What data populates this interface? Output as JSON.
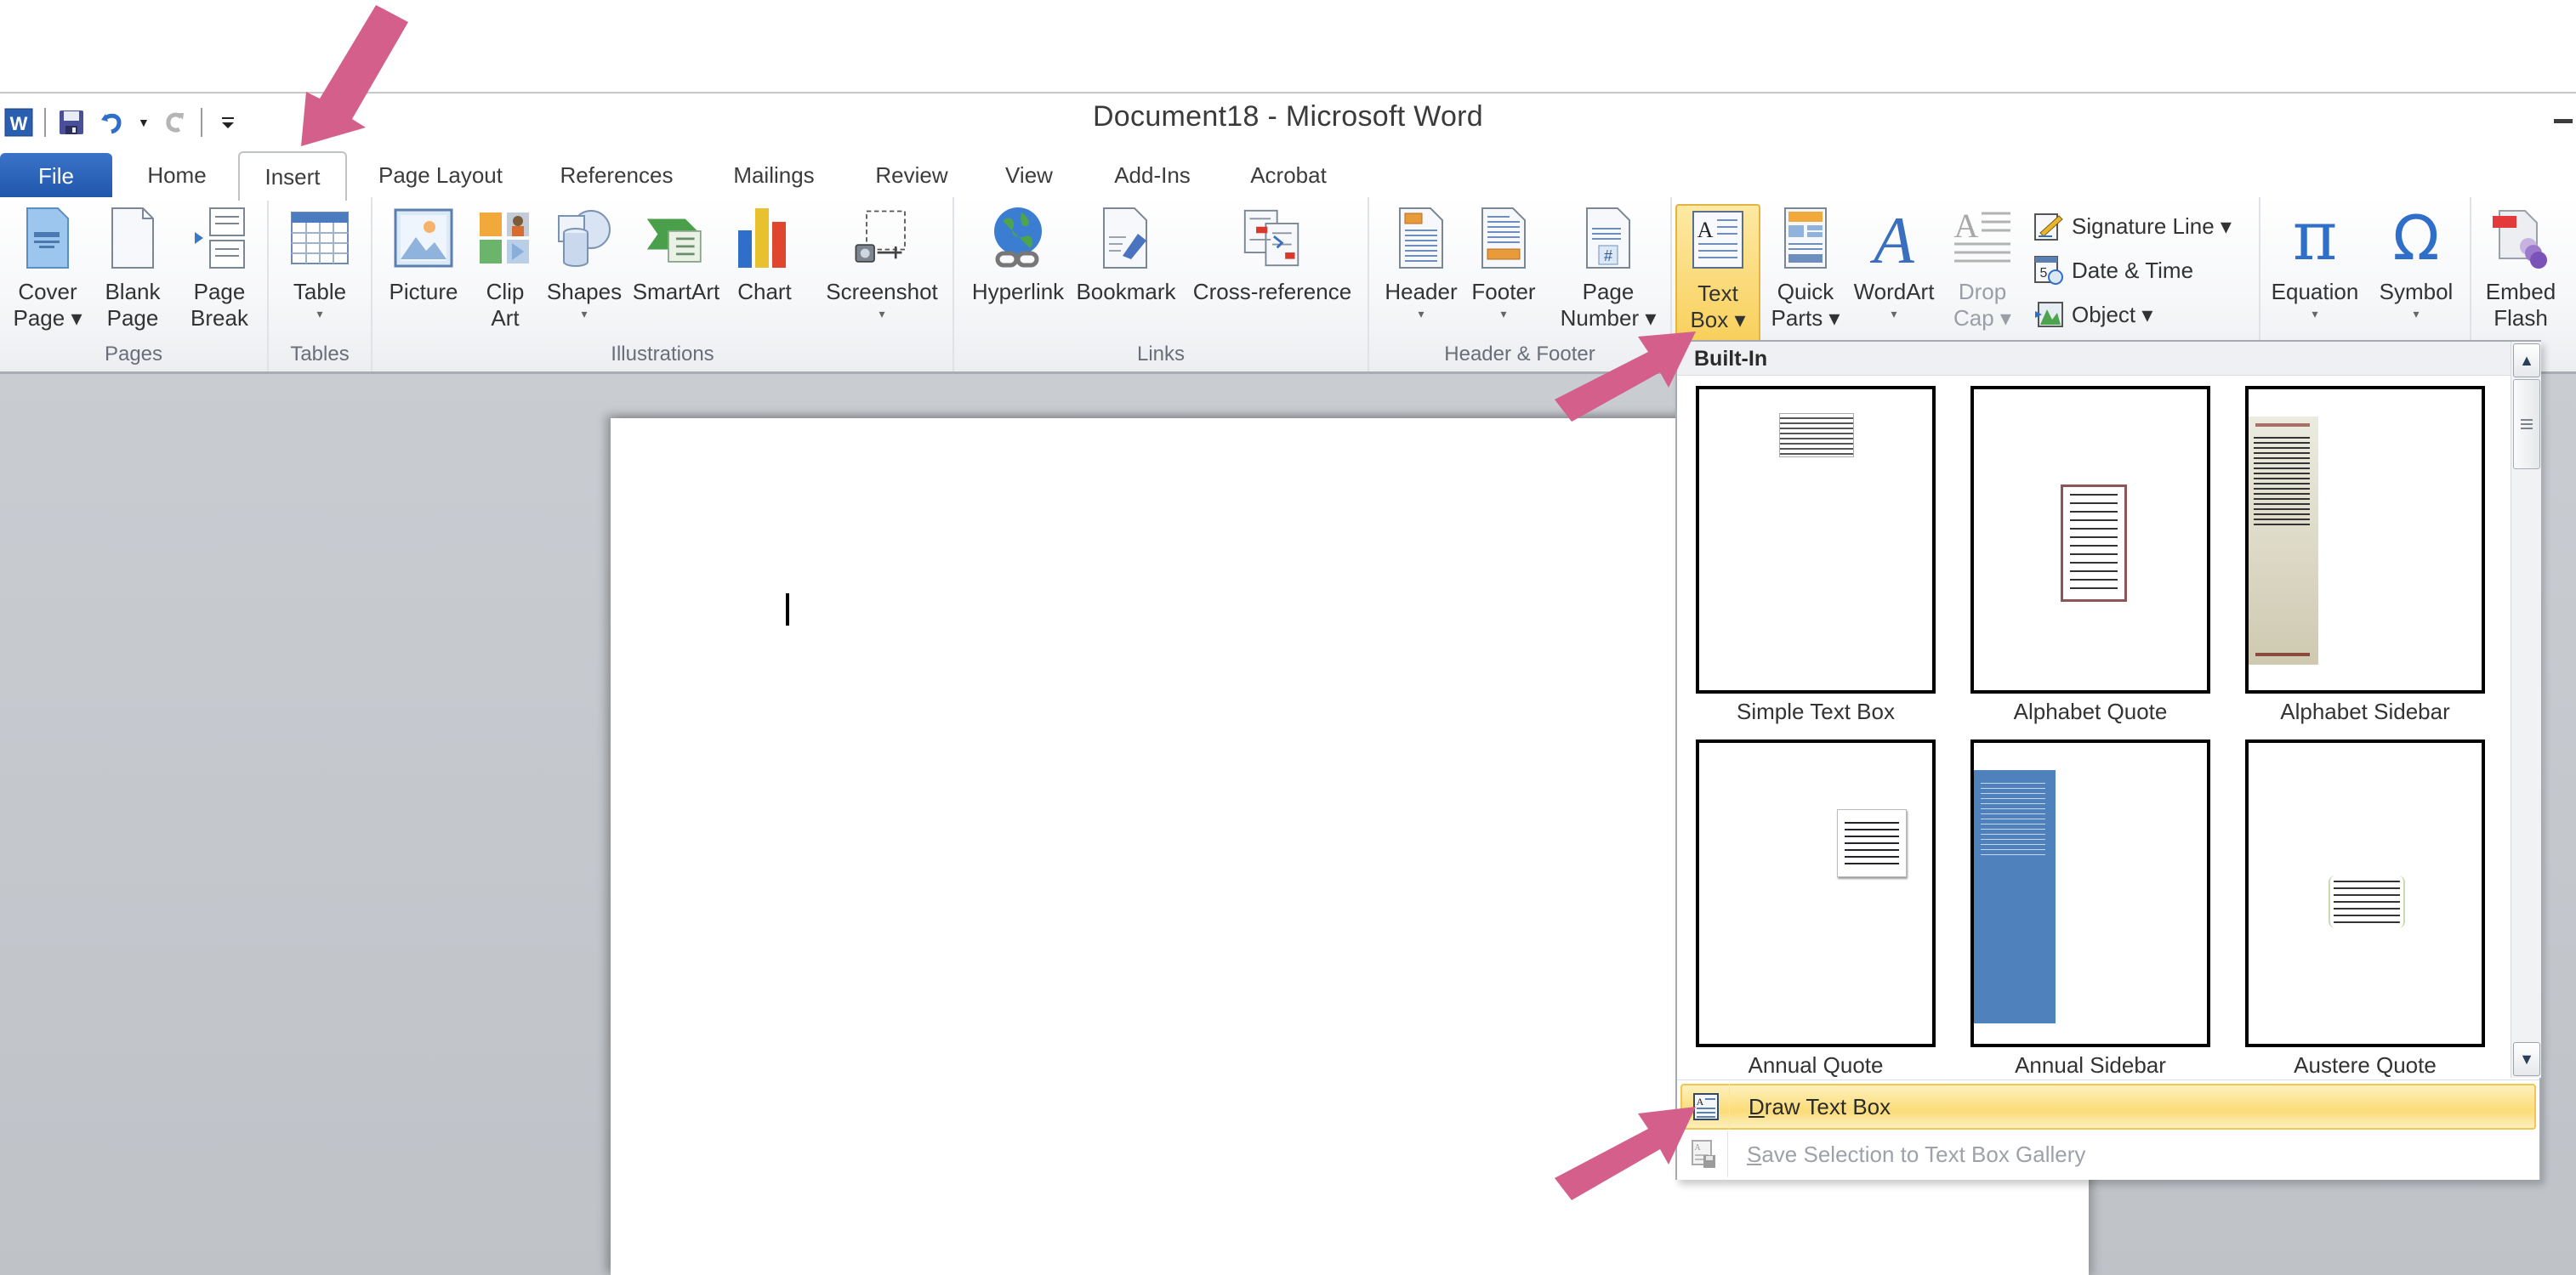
{
  "window": {
    "title": "Document18 - Microsoft Word"
  },
  "quick_access": {
    "items": [
      {
        "name": "word-app-icon"
      },
      {
        "name": "save-icon"
      },
      {
        "name": "undo-icon"
      },
      {
        "name": "redo-icon"
      },
      {
        "name": "customize-qat-icon"
      }
    ]
  },
  "tabs": [
    {
      "label": "File"
    },
    {
      "label": "Home"
    },
    {
      "label": "Insert",
      "active": true
    },
    {
      "label": "Page Layout"
    },
    {
      "label": "References"
    },
    {
      "label": "Mailings"
    },
    {
      "label": "Review"
    },
    {
      "label": "View"
    },
    {
      "label": "Add-Ins"
    },
    {
      "label": "Acrobat"
    }
  ],
  "ribbon": {
    "groups": {
      "pages": {
        "label": "Pages",
        "buttons": [
          {
            "line1": "Cover",
            "line2": "Page ▾"
          },
          {
            "line1": "Blank",
            "line2": "Page"
          },
          {
            "line1": "Page",
            "line2": "Break"
          }
        ]
      },
      "tables": {
        "label": "Tables",
        "buttons": [
          {
            "line1": "Table",
            "line2": "▾"
          }
        ]
      },
      "illustrations": {
        "label": "Illustrations",
        "buttons": [
          {
            "line1": "Picture",
            "line2": ""
          },
          {
            "line1": "Clip",
            "line2": "Art"
          },
          {
            "line1": "Shapes",
            "line2": "▾"
          },
          {
            "line1": "SmartArt",
            "line2": ""
          },
          {
            "line1": "Chart",
            "line2": ""
          },
          {
            "line1": "Screenshot",
            "line2": "▾"
          }
        ]
      },
      "links": {
        "label": "Links",
        "buttons": [
          {
            "line1": "Hyperlink"
          },
          {
            "line1": "Bookmark"
          },
          {
            "line1": "Cross-reference"
          }
        ]
      },
      "header_footer": {
        "label": "Header & Footer",
        "buttons": [
          {
            "line1": "Header",
            "line2": "▾"
          },
          {
            "line1": "Footer",
            "line2": "▾"
          },
          {
            "line1": "Page",
            "line2": "Number ▾"
          }
        ]
      },
      "text": {
        "buttons": [
          {
            "line1": "Text",
            "line2": "Box ▾",
            "state": "pressed"
          },
          {
            "line1": "Quick",
            "line2": "Parts ▾"
          },
          {
            "line1": "WordArt",
            "line2": "▾"
          },
          {
            "line1": "Drop",
            "line2": "Cap ▾",
            "state": "disabled"
          }
        ],
        "small_buttons": [
          {
            "label": "Signature Line ▾"
          },
          {
            "label": "Date & Time"
          },
          {
            "label": "Object ▾"
          }
        ]
      },
      "symbols": {
        "buttons": [
          {
            "line1": "Equation",
            "line2": "▾"
          },
          {
            "line1": "Symbol",
            "line2": "▾"
          }
        ]
      },
      "flash": {
        "buttons": [
          {
            "line1": "Embed",
            "line2": "Flash"
          }
        ]
      }
    }
  },
  "textbox_gallery": {
    "section_header": "Built-In",
    "items": [
      {
        "label": "Simple Text Box"
      },
      {
        "label": "Alphabet Quote"
      },
      {
        "label": "Alphabet Sidebar"
      },
      {
        "label": "Annual Quote"
      },
      {
        "label": "Annual Sidebar"
      },
      {
        "label": "Austere Quote"
      }
    ],
    "menu": [
      {
        "label_accel": "D",
        "label_rest": "raw Text Box",
        "state": "highlighted"
      },
      {
        "label_accel": "S",
        "label_rest": "ave Selection to Text Box Gallery",
        "state": "disabled"
      }
    ]
  },
  "colors": {
    "accent_file_tab": "#2b62b8",
    "highlight": "#f8cf5a",
    "annotation_arrow": "#d45f8a",
    "annual_sidebar_blue": "#4f81bd"
  }
}
